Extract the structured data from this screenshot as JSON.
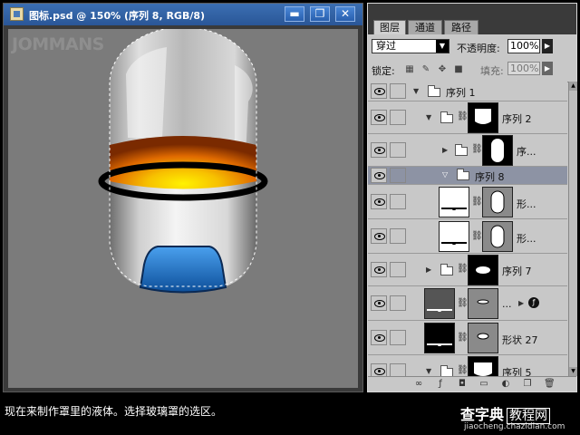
{
  "document": {
    "title": "图标.psd @ 150% (序列 8, RGB/8)",
    "minimize_icon": "▬",
    "restore_icon": "❐",
    "close_icon": "✕",
    "watermark": "JOMMANS"
  },
  "layers_panel": {
    "tabs": [
      {
        "label": "图层",
        "active": true
      },
      {
        "label": "通道",
        "active": false
      },
      {
        "label": "路径",
        "active": false
      }
    ],
    "blend_mode": "穿过",
    "opacity_label": "不透明度:",
    "opacity_value": "100%",
    "lock_label": "锁定:",
    "fill_label": "填充:",
    "fill_value": "100%",
    "layers": [
      {
        "name": "序列 1",
        "type": "group",
        "expanded": true,
        "selected": false
      },
      {
        "name": "序列 2",
        "type": "group",
        "expanded": true,
        "selected": false
      },
      {
        "name": "序...",
        "type": "group",
        "expanded": false,
        "selected": false
      },
      {
        "name": "序列 8",
        "type": "group",
        "expanded": true,
        "selected": true
      },
      {
        "name": "形...",
        "type": "shape",
        "selected": false
      },
      {
        "name": "形...",
        "type": "shape",
        "selected": false
      },
      {
        "name": "序列 7",
        "type": "group",
        "expanded": false,
        "selected": false
      },
      {
        "name": "...",
        "type": "shape-fx",
        "selected": false
      },
      {
        "name": "形状 27",
        "type": "shape",
        "selected": false
      },
      {
        "name": "序列 5",
        "type": "group",
        "expanded": true,
        "selected": false
      }
    ]
  },
  "caption": "现在来制作罩里的液体。选择玻璃罩的选区。",
  "site": {
    "logo_part1": "查字典",
    "logo_part2": "教程网",
    "url": "jiaocheng.chazidian.com"
  },
  "colors": {
    "title_bar": "#2f62a8",
    "canvas_bg": "#7b7b7b",
    "selected_layer": "#8d93a4",
    "liquid_top": "#f0d000",
    "liquid_bottom": "#d04000",
    "visor_blue": "#1f6fc0"
  }
}
